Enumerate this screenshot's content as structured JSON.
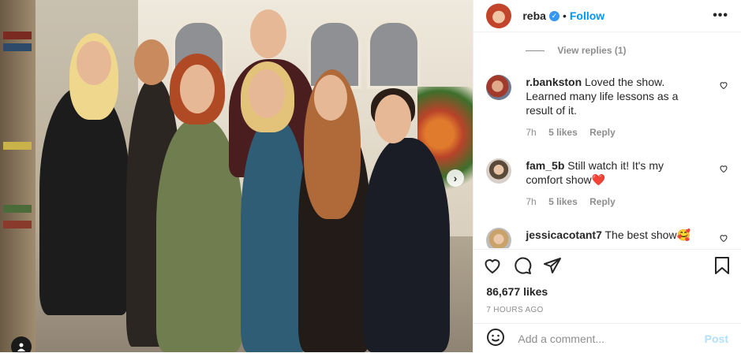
{
  "post": {
    "username": "reba",
    "follow_label": "Follow",
    "separator": "•"
  },
  "comments": {
    "view_replies": "View replies (1)",
    "items": [
      {
        "user": "r.bankston",
        "text": "Loved the show. Learned many life lessons as a result of it.",
        "time": "7h",
        "likes": "5 likes",
        "reply": "Reply"
      },
      {
        "user": "fam_5b",
        "text": "Still watch it! It's my comfort show❤️",
        "time": "7h",
        "likes": "5 likes",
        "reply": "Reply"
      },
      {
        "user": "jessicacotant7",
        "text": "The best show🥰"
      }
    ]
  },
  "stats": {
    "likes": "86,677 likes",
    "posted": "7 HOURS AGO"
  },
  "composer": {
    "placeholder": "Add a comment...",
    "post_label": "Post"
  },
  "colors": {
    "accent": "#0095f6",
    "verified": "#3897f0",
    "muted": "#8e8e8e",
    "post_disabled": "#b2dffc"
  },
  "icons": [
    "verified-icon",
    "more-icon",
    "heart-icon",
    "comment-icon",
    "share-icon",
    "save-icon",
    "emoji-icon",
    "next-arrow-icon",
    "user-tag-icon"
  ]
}
